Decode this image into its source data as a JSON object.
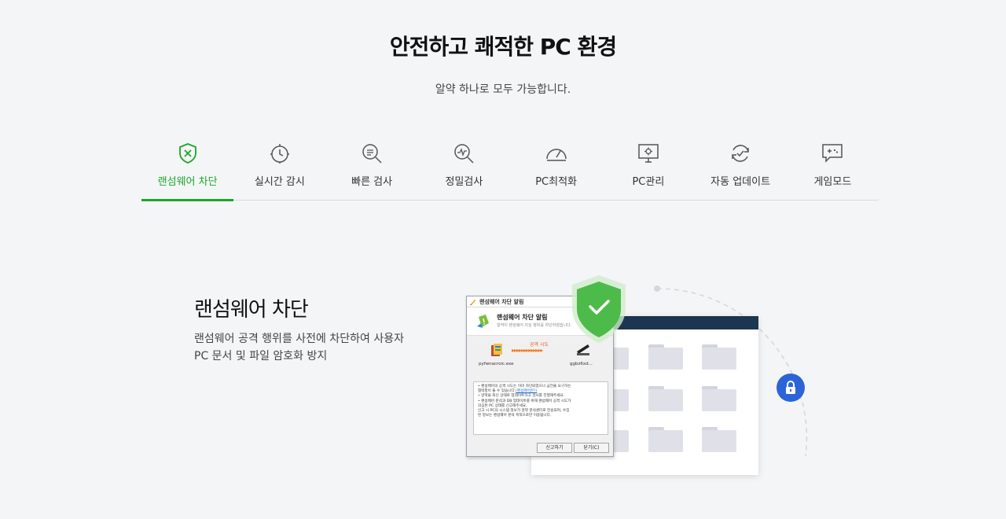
{
  "hero": {
    "title": "안전하고 쾌적한 PC 환경",
    "subtitle": "알약 하나로 모두 가능합니다."
  },
  "tabs": [
    {
      "label": "랜섬웨어 차단",
      "icon": "shield-x-icon",
      "active": true
    },
    {
      "label": "실시간 감시",
      "icon": "clock-icon",
      "active": false
    },
    {
      "label": "빠른 검사",
      "icon": "search-list-icon",
      "active": false
    },
    {
      "label": "정밀검사",
      "icon": "search-pulse-icon",
      "active": false
    },
    {
      "label": "PC최적화",
      "icon": "gauge-icon",
      "active": false
    },
    {
      "label": "PC관리",
      "icon": "monitor-gear-icon",
      "active": false
    },
    {
      "label": "자동 업데이트",
      "icon": "refresh-check-icon",
      "active": false
    },
    {
      "label": "게임모드",
      "icon": "gamepad-chat-icon",
      "active": false
    }
  ],
  "feature": {
    "title": "랜섬웨어 차단",
    "desc_line1": "랜섬웨어 공격 행위를 사전에 차단하여 사용자",
    "desc_line2": "PC 문서 및 파일 암호화 방지"
  },
  "dialog": {
    "window_title": "랜섬웨어 차단 알림",
    "header_title": "랜섬웨어 차단 알림",
    "header_sub": "알약이 랜섬웨어 의심 행위를 차단하였습니다.",
    "attack_label": "공격 시도",
    "arrows": "▸▸▸▸▸▸▸▸▸▸▸▸▸",
    "source_file": "pyfwnacroic.exe",
    "target_file": "ggbz6xd...",
    "msg_line1": "• 랜섬웨어의 공격 시도는 이미 차단되었으나 금전을 요구하는",
    "msg_line2": "   협박창이 뜰 수 있습니다.",
    "msg_link": "(랜섬웨어란?)",
    "msg_line3": "• 알약을 최신 상태로 업데이트하고 검사를 진행해주세요.",
    "msg_line4": "• 랜섬웨어 분석과 DB 업데이트를 위해 랜섬웨어 공격 시도가",
    "msg_line5": "   의심된 PC 상태를 신고해주세요.",
    "msg_line6": "   신고 시 PC의 시스템 정보가 알약 분석센터로 전송되며, 수집",
    "msg_line7": "   된 정보는 랜섬웨어 분석 목적으로만 이용됩니다.",
    "report_button": "신고하기",
    "close_button": "닫기(C)"
  },
  "colors": {
    "accent_green": "#1aa727",
    "shield_green": "#4cbb4a",
    "lock_blue": "#2c64d8",
    "browser_bar": "#1c3551"
  }
}
